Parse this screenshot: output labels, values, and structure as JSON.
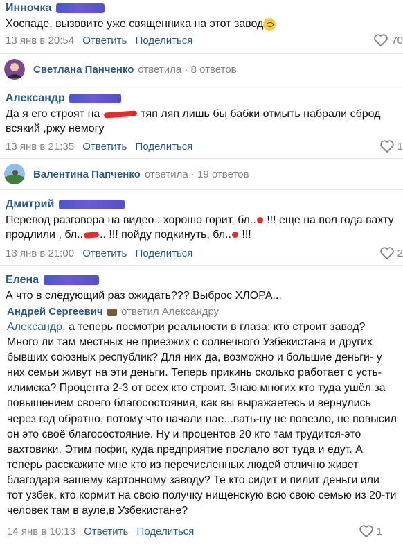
{
  "comments": [
    {
      "author": "Инночка",
      "text": "Хоспаде, вызовите уже священника на этот завод",
      "date": "13 янв в 20:54",
      "reply_label": "Ответить",
      "share_label": "Поделиться",
      "likes": "70"
    },
    {
      "author": "Александр",
      "text_part1": "Да я его строят на ",
      "text_part2": " тяп ляп лишь бы бабки отмыть набрали сброд всякий ,ржу немогу",
      "date": "13 янв в 21:35",
      "reply_label": "Ответить",
      "share_label": "Поделиться",
      "likes": "1"
    },
    {
      "author": "Дмитрий",
      "text_part1": "Перевод разговора на видео : хорошо горит, бл..",
      "text_part2": " !!! еще на пол года вахту продлили , бл..",
      "text_part3": ".. !!! пойду подкинуть, бл..",
      "text_part4": " !!!",
      "date": "13 янв в 21:00",
      "reply_label": "Ответить",
      "share_label": "Поделиться",
      "likes": "2"
    },
    {
      "author": "Елена",
      "text": "А что в следующий раз ожидать??? Выброс ХЛОРА...",
      "reply": {
        "author": "Андрей Сергеевич",
        "replied_to": "ответил Александру",
        "mention": "Александр",
        "text": ", а теперь посмотри реальности в глаза: кто строит завод? Много ли там местных не приезжих с солнечного Узбекистана и других бывших союзных республик? Для них да, возможно и большие деньги- у них семьи живут на эти деньги. Теперь прикинь сколько работает с усть-илимска? Процента 2-3 от всех кто строит. Знаю многих кто туда ушёл за повышением своего благосостояния, как вы выражаетесь и вернулись через год обратно, потому что начали нае...вать-ну не повезло, не повысил он это своё благосостояние. Ну и процентов 20 кто там трудится-это вахтовики. Этим пофиг, куда предприятие послало вот туда и едут. А теперь расскажите мне кто из перечисленных людей отлично живет благодаря вашему картонному заводу? Те кто сидит и пилит деньги или тот узбек, кто кормит на свою получку нищенскую всю свою семью из 20-ти человек там в ауле,в Узбекистане?",
        "date": "14 янв в 10:13",
        "reply_label": "Ответить",
        "share_label": "Поделиться",
        "likes": "1"
      }
    }
  ],
  "replies_rows": [
    {
      "name": "Светлана Панченко",
      "verb": "ответила",
      "count": "8 ответов"
    },
    {
      "name": "Валентина Папченко",
      "verb": "ответила",
      "count": "19 ответов"
    }
  ],
  "colors": {
    "link": "#2a5885",
    "muted": "#828282",
    "redact": "#5a55cf",
    "scribble": "#e32c2c"
  }
}
